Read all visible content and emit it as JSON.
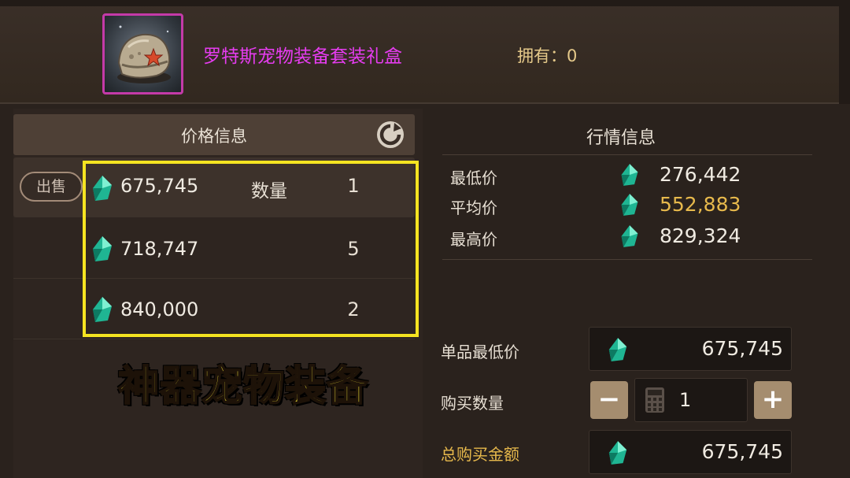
{
  "item": {
    "name": "罗特斯宠物装备套装礼盒",
    "owned_label": "拥有：0"
  },
  "price_panel": {
    "title": "价格信息",
    "sell_button": "出售",
    "quantity_label": "数量",
    "listings": [
      {
        "price": "675,745",
        "qty": "1"
      },
      {
        "price": "718,747",
        "qty": "5"
      },
      {
        "price": "840,000",
        "qty": "2"
      }
    ]
  },
  "market_panel": {
    "title": "行情信息",
    "rows": [
      {
        "label": "最低价",
        "value": "276,442",
        "color": "#f0ebe2"
      },
      {
        "label": "平均价",
        "value": "552,883",
        "color": "#e7b94c"
      },
      {
        "label": "最高价",
        "value": "829,324",
        "color": "#f0ebe2"
      }
    ]
  },
  "purchase": {
    "unit_price_label": "单品最低价",
    "unit_price": "675,745",
    "quantity_label": "购买数量",
    "quantity": "1",
    "minus": "−",
    "plus": "+",
    "total_label": "总购买金额",
    "total": "675,745"
  },
  "caption": "神器宠物装备",
  "colors": {
    "item_name": "#e63cf0",
    "highlight": "#f5e421",
    "gem": "#2fd6b0",
    "gold": "#e7b94c"
  }
}
